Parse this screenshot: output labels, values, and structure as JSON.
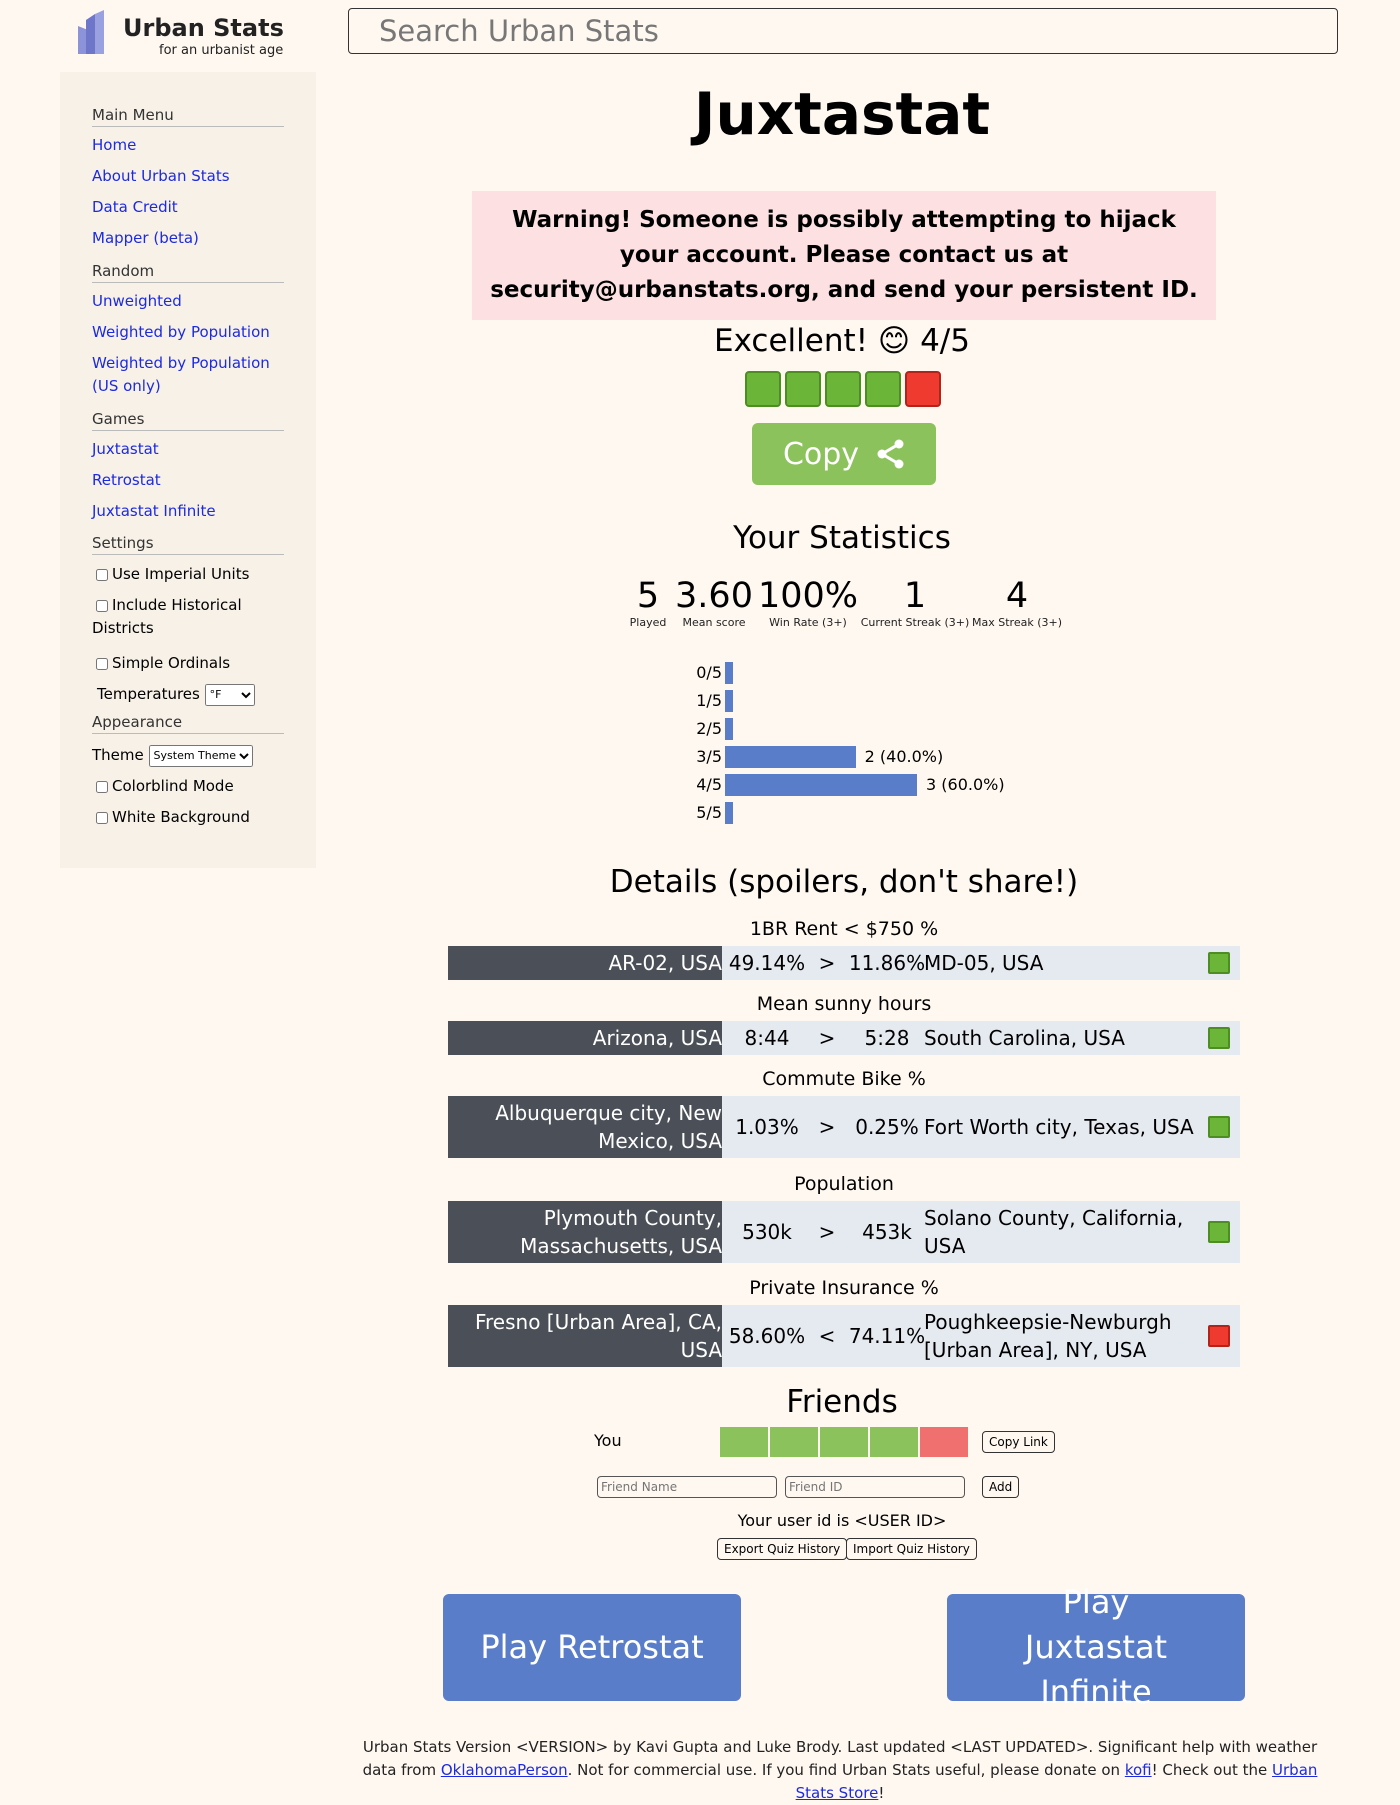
{
  "logo": {
    "title": "Urban Stats",
    "subtitle": "for an urbanist age"
  },
  "search": {
    "placeholder": "Search Urban Stats"
  },
  "sidebar": {
    "main_menu": "Main Menu",
    "home": "Home",
    "about": "About Urban Stats",
    "data_credit": "Data Credit",
    "mapper": "Mapper (beta)",
    "random": "Random",
    "unweighted": "Unweighted",
    "weighted_pop": "Weighted by Population",
    "weighted_pop_us": "Weighted by Population (US only)",
    "games": "Games",
    "juxtastat": "Juxtastat",
    "retrostat": "Retrostat",
    "juxtastat_infinite": "Juxtastat Infinite",
    "settings": "Settings",
    "imperial": "Use Imperial Units",
    "historical": "Include Historical Districts",
    "ordinals": "Simple Ordinals",
    "temperatures": "Temperatures",
    "temp_unit": "°F",
    "appearance": "Appearance",
    "theme": "Theme",
    "theme_value": "System Theme",
    "colorblind": "Colorblind Mode",
    "white_bg": "White Background"
  },
  "title": "Juxtastat",
  "warning": "Warning! Someone is possibly attempting to hijack your account. Please contact us at security@urbanstats.org, and send your persistent ID.",
  "score": {
    "text": "Excellent! 😊 4/5",
    "results": [
      true,
      true,
      true,
      true,
      false
    ]
  },
  "copy_label": "Copy",
  "statistics": {
    "heading": "Your Statistics",
    "items": [
      {
        "value": "5",
        "label": "Played"
      },
      {
        "value": "3.60",
        "label": "Mean score"
      },
      {
        "value": "100%",
        "label": "Win Rate (3+)"
      },
      {
        "value": "1",
        "label": "Current Streak (3+)"
      },
      {
        "value": "4",
        "label": "Max Streak (3+)"
      }
    ]
  },
  "distribution": [
    {
      "label": "0/5",
      "count": 0,
      "text": ""
    },
    {
      "label": "1/5",
      "count": 0,
      "text": ""
    },
    {
      "label": "2/5",
      "count": 0,
      "text": ""
    },
    {
      "label": "3/5",
      "count": 2,
      "text": "2 (40.0%)"
    },
    {
      "label": "4/5",
      "count": 3,
      "text": "3 (60.0%)"
    },
    {
      "label": "5/5",
      "count": 0,
      "text": ""
    }
  ],
  "details": {
    "heading": "Details (spoilers, don't share!)",
    "questions": [
      {
        "title": "1BR Rent < $750 %",
        "left": "AR-02, USA",
        "left_value": "49.14%",
        "op": ">",
        "right_value": "11.86%",
        "right": "MD-05, USA",
        "correct": true
      },
      {
        "title": "Mean sunny hours",
        "left": "Arizona, USA",
        "left_value": "8:44",
        "op": ">",
        "right_value": "5:28",
        "right": "South Carolina, USA",
        "correct": true
      },
      {
        "title": "Commute Bike %",
        "left": "Albuquerque city, New Mexico, USA",
        "left_value": "1.03%",
        "op": ">",
        "right_value": "0.25%",
        "right": "Fort Worth city, Texas, USA",
        "correct": true
      },
      {
        "title": "Population",
        "left": "Plymouth County, Massachusetts, USA",
        "left_value": "530k",
        "op": ">",
        "right_value": "453k",
        "right": "Solano County, California, USA",
        "correct": true
      },
      {
        "title": "Private Insurance %",
        "left": "Fresno [Urban Area], CA, USA",
        "left_value": "58.60%",
        "op": "<",
        "right_value": "74.11%",
        "right": "Poughkeepsie-Newburgh [Urban Area], NY, USA",
        "correct": false
      }
    ]
  },
  "friends": {
    "heading": "Friends",
    "you": "You",
    "copy_link": "Copy Link",
    "name_placeholder": "Friend Name",
    "id_placeholder": "Friend ID",
    "add": "Add",
    "user_id": "Your user id is <USER ID>",
    "export": "Export Quiz History",
    "import": "Import Quiz History"
  },
  "buttons": {
    "retrostat": "Play Retrostat",
    "infinite": "Play Juxtastat Infinite"
  },
  "footer": {
    "text1": "Urban Stats Version <VERSION> by Kavi Gupta and Luke Brody. Last updated <LAST UPDATED>. Significant help with weather data from ",
    "link1": "OklahomaPerson",
    "text2": ". Not for commercial use. If you find Urban Stats useful, please donate on ",
    "link2": "kofi",
    "text3": "! Check out the ",
    "link3": "Urban Stats Store",
    "text4": "!"
  },
  "colors": {
    "correct": "#6bb538",
    "wrong": "#ee3a2f",
    "bar": "#5a7dc9",
    "friend_correct": "#8bc25b",
    "friend_wrong": "#f07070",
    "link": "#1c2ae0"
  }
}
